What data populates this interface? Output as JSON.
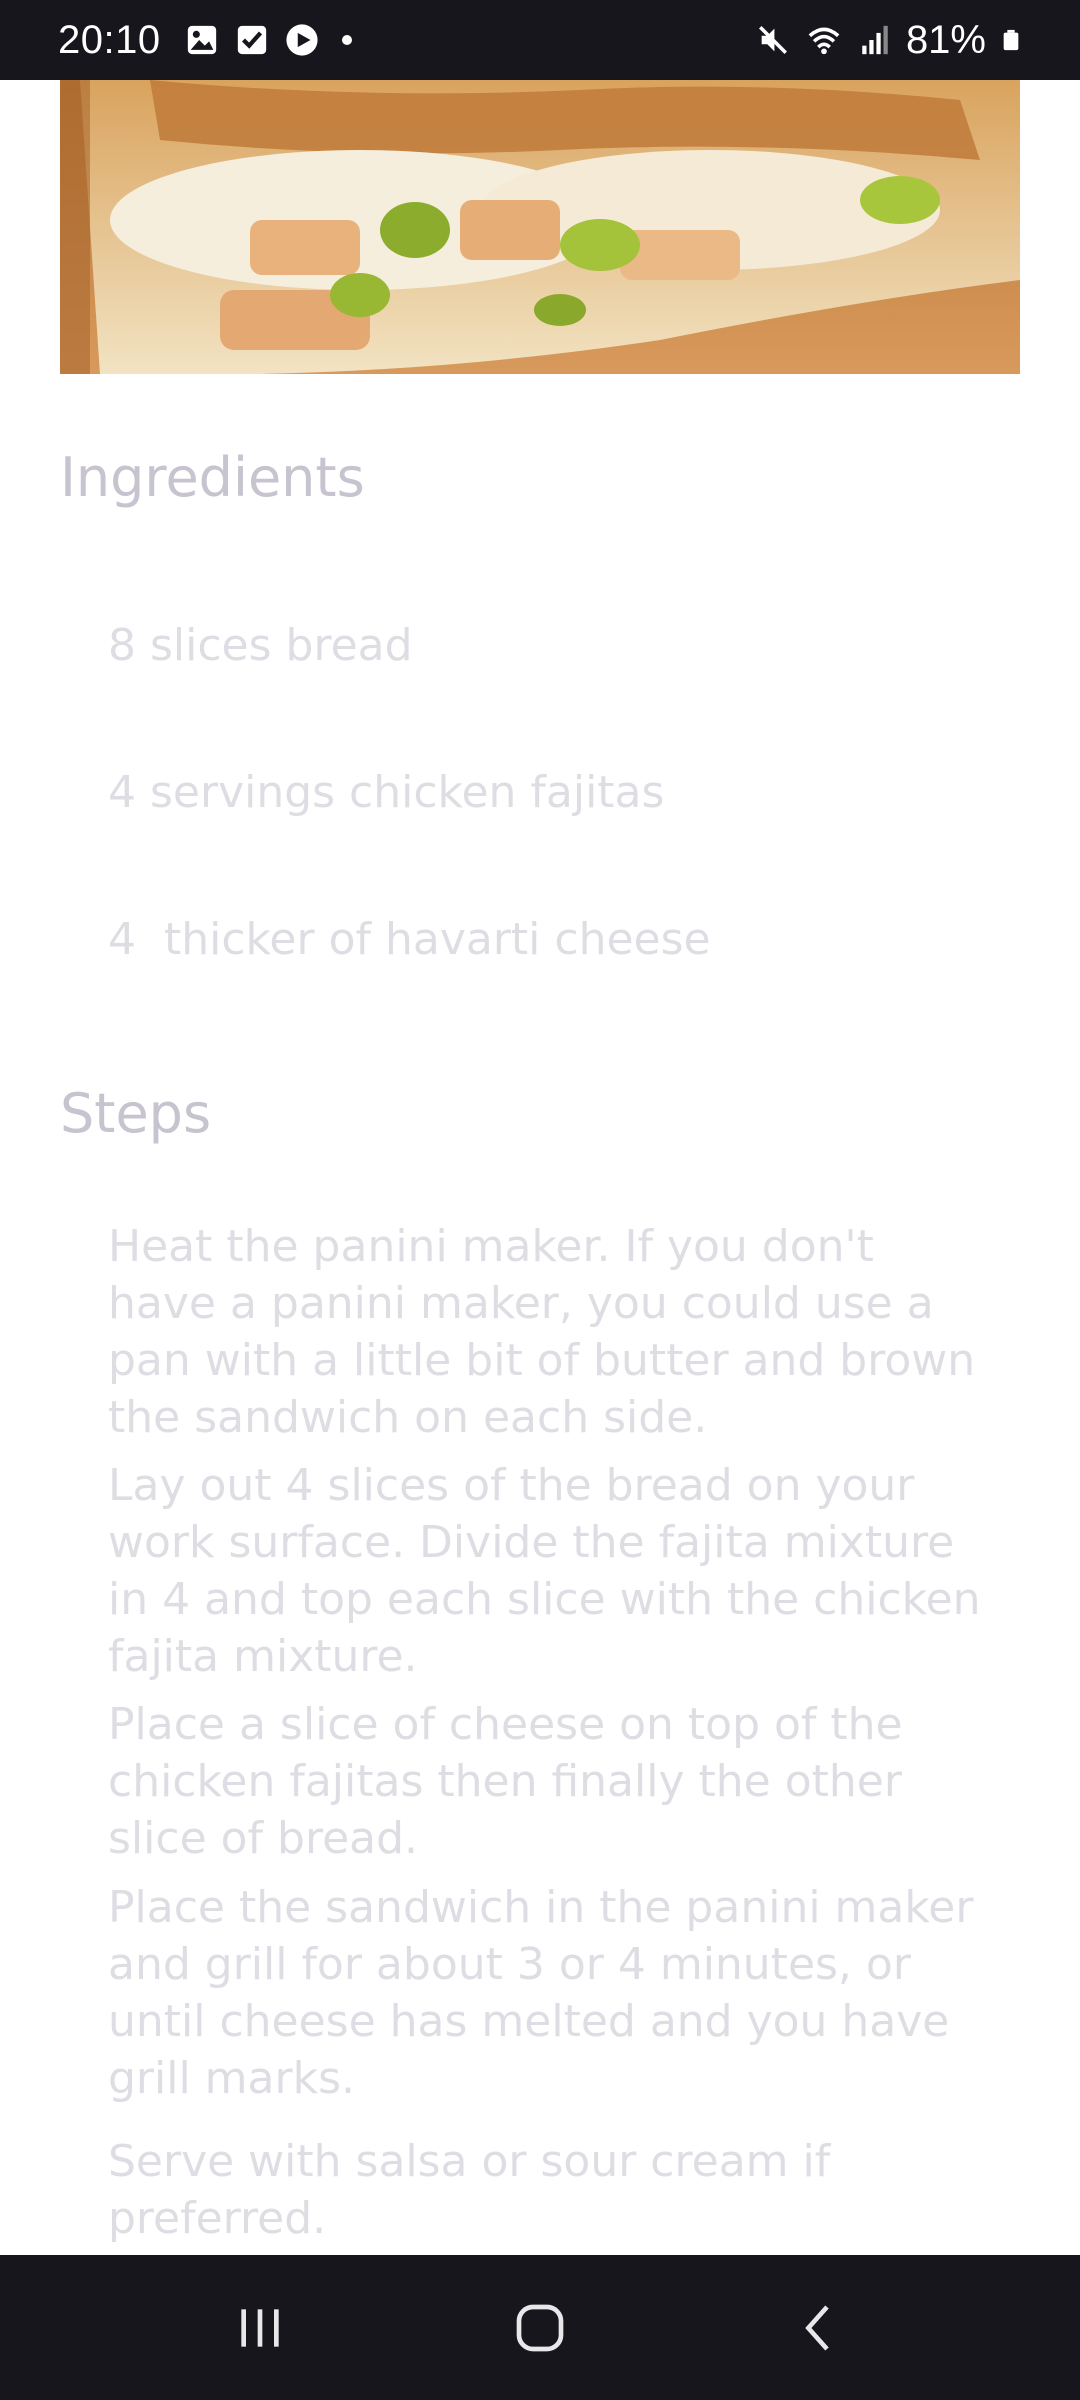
{
  "status_bar": {
    "time": "20:10",
    "battery": "81%",
    "icons_left": [
      "gallery-icon",
      "checkbox-icon",
      "youtube-play-icon",
      "dot-icon"
    ],
    "icons_right": [
      "mute-icon",
      "wifi-icon",
      "signal-icon",
      "battery-icon"
    ]
  },
  "hero_image": {
    "subject": "chicken fajita panini sandwich cut open on wooden board"
  },
  "ingredients": {
    "title": "Ingredients",
    "items": [
      "8 slices bread",
      "4 servings chicken fajitas",
      "4  thicker of havarti cheese"
    ]
  },
  "steps": {
    "title": "Steps",
    "items": [
      "Heat the panini maker. If you don't have a panini maker, you could use a pan with a little bit of butter and brown the sandwich on each side.",
      "Lay out 4 slices of the bread on your work surface. Divide the fajita mixture in 4 and top each slice with the chicken fajita mixture.",
      "Place a slice of cheese on top of the chicken fajitas then finally the other slice of bread.",
      "Place the sandwich in the panini maker and grill for about 3 or 4 minutes, or until cheese has melted and you have grill marks.",
      "Serve with salsa or sour cream if preferred."
    ]
  },
  "nav_bar": {
    "buttons": [
      "recent-apps-icon",
      "home-icon",
      "back-icon"
    ]
  },
  "colors": {
    "bar_background": "#16161c",
    "title_text": "#c7c3cf",
    "body_text": "#dedde3"
  }
}
